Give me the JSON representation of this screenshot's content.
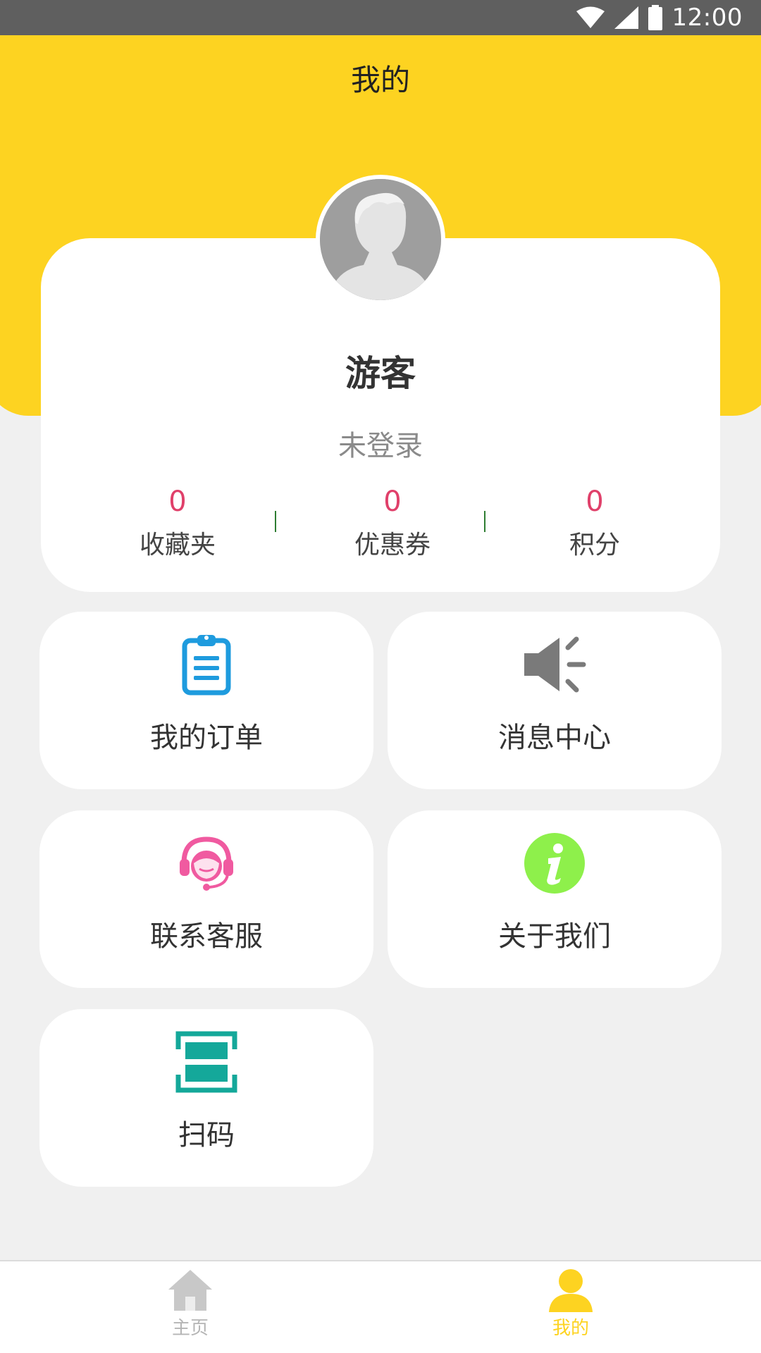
{
  "status_bar": {
    "time": "12:00"
  },
  "header": {
    "title": "我的"
  },
  "profile": {
    "name": "游客",
    "status": "未登录",
    "stats": [
      {
        "value": "0",
        "label": "收藏夹"
      },
      {
        "value": "0",
        "label": "优惠券"
      },
      {
        "value": "0",
        "label": "积分"
      }
    ]
  },
  "menu": [
    {
      "label": "我的订单",
      "icon": "clipboard-icon",
      "color": "#1e9bde"
    },
    {
      "label": "消息中心",
      "icon": "speaker-icon",
      "color": "#7a7a7a"
    },
    {
      "label": "联系客服",
      "icon": "customer-service-icon",
      "color": "#f05aa0"
    },
    {
      "label": "关于我们",
      "icon": "info-icon",
      "color": "#8ef04b"
    },
    {
      "label": "扫码",
      "icon": "scan-icon",
      "color": "#14a89a"
    }
  ],
  "bottom_nav": [
    {
      "label": "主页",
      "icon": "home-icon",
      "active": false,
      "color": "#c8c8c8"
    },
    {
      "label": "我的",
      "icon": "user-icon",
      "active": true,
      "color": "#fdd321"
    }
  ],
  "colors": {
    "accent": "#fdd321",
    "stat_number": "#e0406a",
    "background": "#f0f0f0"
  }
}
